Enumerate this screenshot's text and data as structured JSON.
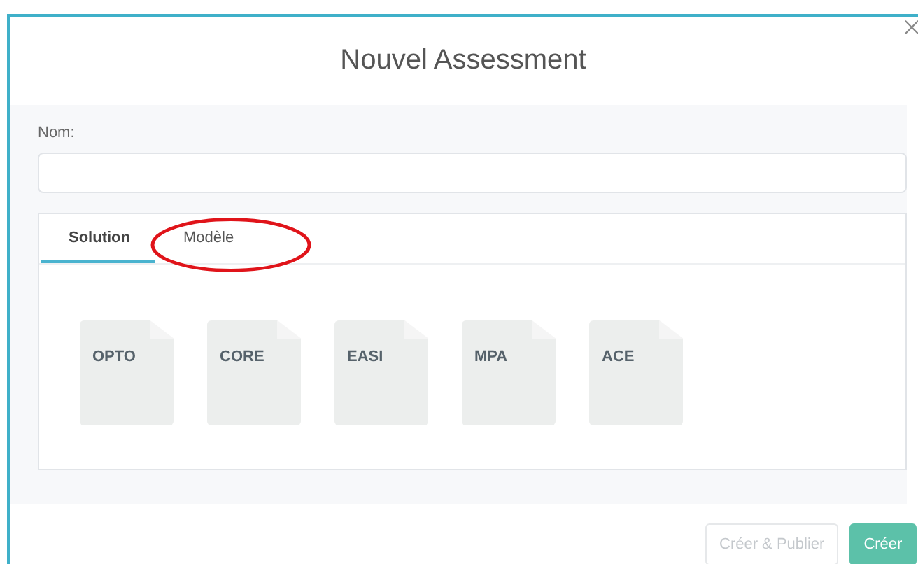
{
  "dialog": {
    "title": "Nouvel Assessment"
  },
  "name_field": {
    "label": "Nom:"
  },
  "tabs": [
    {
      "label": "Solution",
      "selected": true,
      "circled": false
    },
    {
      "label": "Modèle",
      "selected": false,
      "circled": true
    }
  ],
  "templates": [
    {
      "label": "OPTO"
    },
    {
      "label": "CORE"
    },
    {
      "label": "EASI"
    },
    {
      "label": "MPA"
    },
    {
      "label": "ACE"
    }
  ],
  "buttons": [
    {
      "label": "Créer & Publier",
      "kind": "secondary",
      "disabled": true
    },
    {
      "label": "Créer",
      "kind": "primary",
      "disabled": false
    }
  ]
}
